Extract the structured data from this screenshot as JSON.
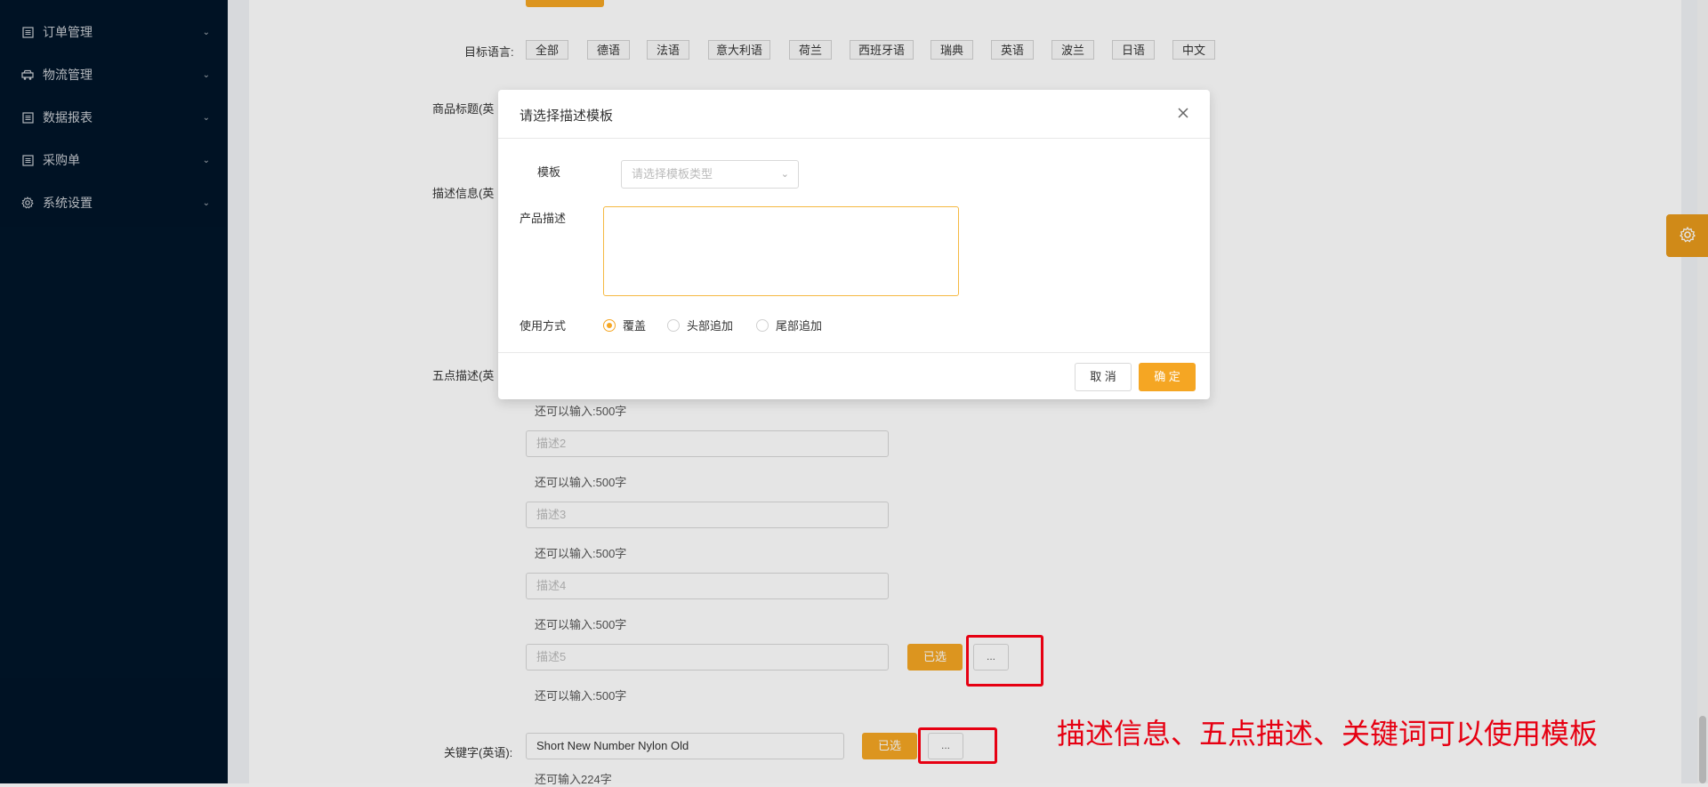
{
  "sidebar": {
    "items": [
      {
        "label": "订单管理",
        "icon": "document-icon"
      },
      {
        "label": "物流管理",
        "icon": "truck-icon"
      },
      {
        "label": "数据报表",
        "icon": "document-icon"
      },
      {
        "label": "采购单",
        "icon": "document-icon"
      },
      {
        "label": "系统设置",
        "icon": "gear-icon"
      }
    ]
  },
  "form": {
    "target_language_label": "目标语言:",
    "languages": [
      "全部",
      "德语",
      "法语",
      "意大利语",
      "荷兰",
      "西班牙语",
      "瑞典",
      "英语",
      "波兰",
      "日语",
      "中文"
    ],
    "title_label": "商品标题(英",
    "description_label": "描述信息(英",
    "bullet_label": "五点描述(英",
    "remaining_1": "还可以输入:500字",
    "desc2_placeholder": "描述2",
    "remaining_2": "还可以输入:500字",
    "desc3_placeholder": "描述3",
    "remaining_3": "还可以输入:500字",
    "desc4_placeholder": "描述4",
    "remaining_4": "还可以输入:500字",
    "desc5_placeholder": "描述5",
    "selected_btn": "已选",
    "dots_btn": "...",
    "remaining_5": "还可以输入:500字",
    "keyword_label": "关键字(英语):",
    "keyword_value": "Short New Number Nylon Old",
    "keyword_selected_btn": "已选",
    "keyword_dots_btn": "...",
    "keyword_remaining": "还可输入224字"
  },
  "modal": {
    "title": "请选择描述模板",
    "template_label": "模板",
    "template_placeholder": "请选择模板类型",
    "product_desc_label": "产品描述",
    "usage_label": "使用方式",
    "options": [
      "覆盖",
      "头部追加",
      "尾部追加"
    ],
    "selected_option": "覆盖",
    "cancel": "取 消",
    "ok": "确 定"
  },
  "annotation": "描述信息、五点描述、关键词可以使用模板",
  "colors": {
    "sidebar_bg": "#001529",
    "accent": "#f5a623",
    "annotation_red": "#e60012"
  }
}
